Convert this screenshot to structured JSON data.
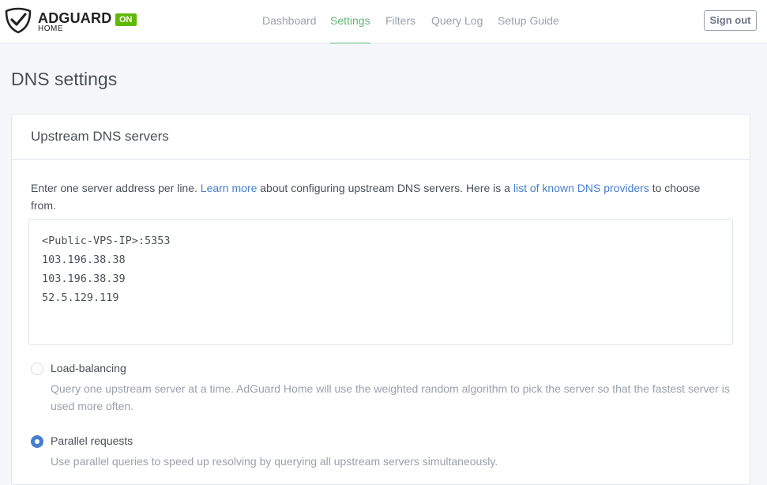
{
  "header": {
    "brand": {
      "name": "ADGUARD",
      "sub": "HOME",
      "status_badge": "ON",
      "logo_icon": "adguard-shield-check-icon"
    },
    "nav": [
      {
        "label": "Dashboard",
        "active": false
      },
      {
        "label": "Settings",
        "active": true
      },
      {
        "label": "Filters",
        "active": false
      },
      {
        "label": "Query Log",
        "active": false
      },
      {
        "label": "Setup Guide",
        "active": false
      }
    ],
    "signout_label": "Sign out"
  },
  "page": {
    "title": "DNS settings"
  },
  "upstream_card": {
    "title": "Upstream DNS servers",
    "desc": {
      "part1": "Enter one server address per line. ",
      "learn_more": "Learn more",
      "part2": " about configuring upstream DNS servers. Here is a ",
      "providers_link": "list of known DNS providers",
      "part3": " to choose from."
    },
    "servers": [
      "<Public-VPS-IP>:5353",
      "103.196.38.38",
      "103.196.38.39",
      "52.5.129.119"
    ],
    "options": [
      {
        "label": "Load-balancing",
        "desc": "Query one upstream server at a time. AdGuard Home will use the weighted random algorithm to pick the server so that the fastest server is used more often.",
        "checked": false
      },
      {
        "label": "Parallel requests",
        "desc": "Use parallel queries to speed up resolving by querying all upstream servers simultaneously.",
        "checked": true
      }
    ]
  },
  "colors": {
    "accent_green": "#66b574",
    "badge_green": "#5eba00",
    "link_blue": "#467fcf"
  }
}
